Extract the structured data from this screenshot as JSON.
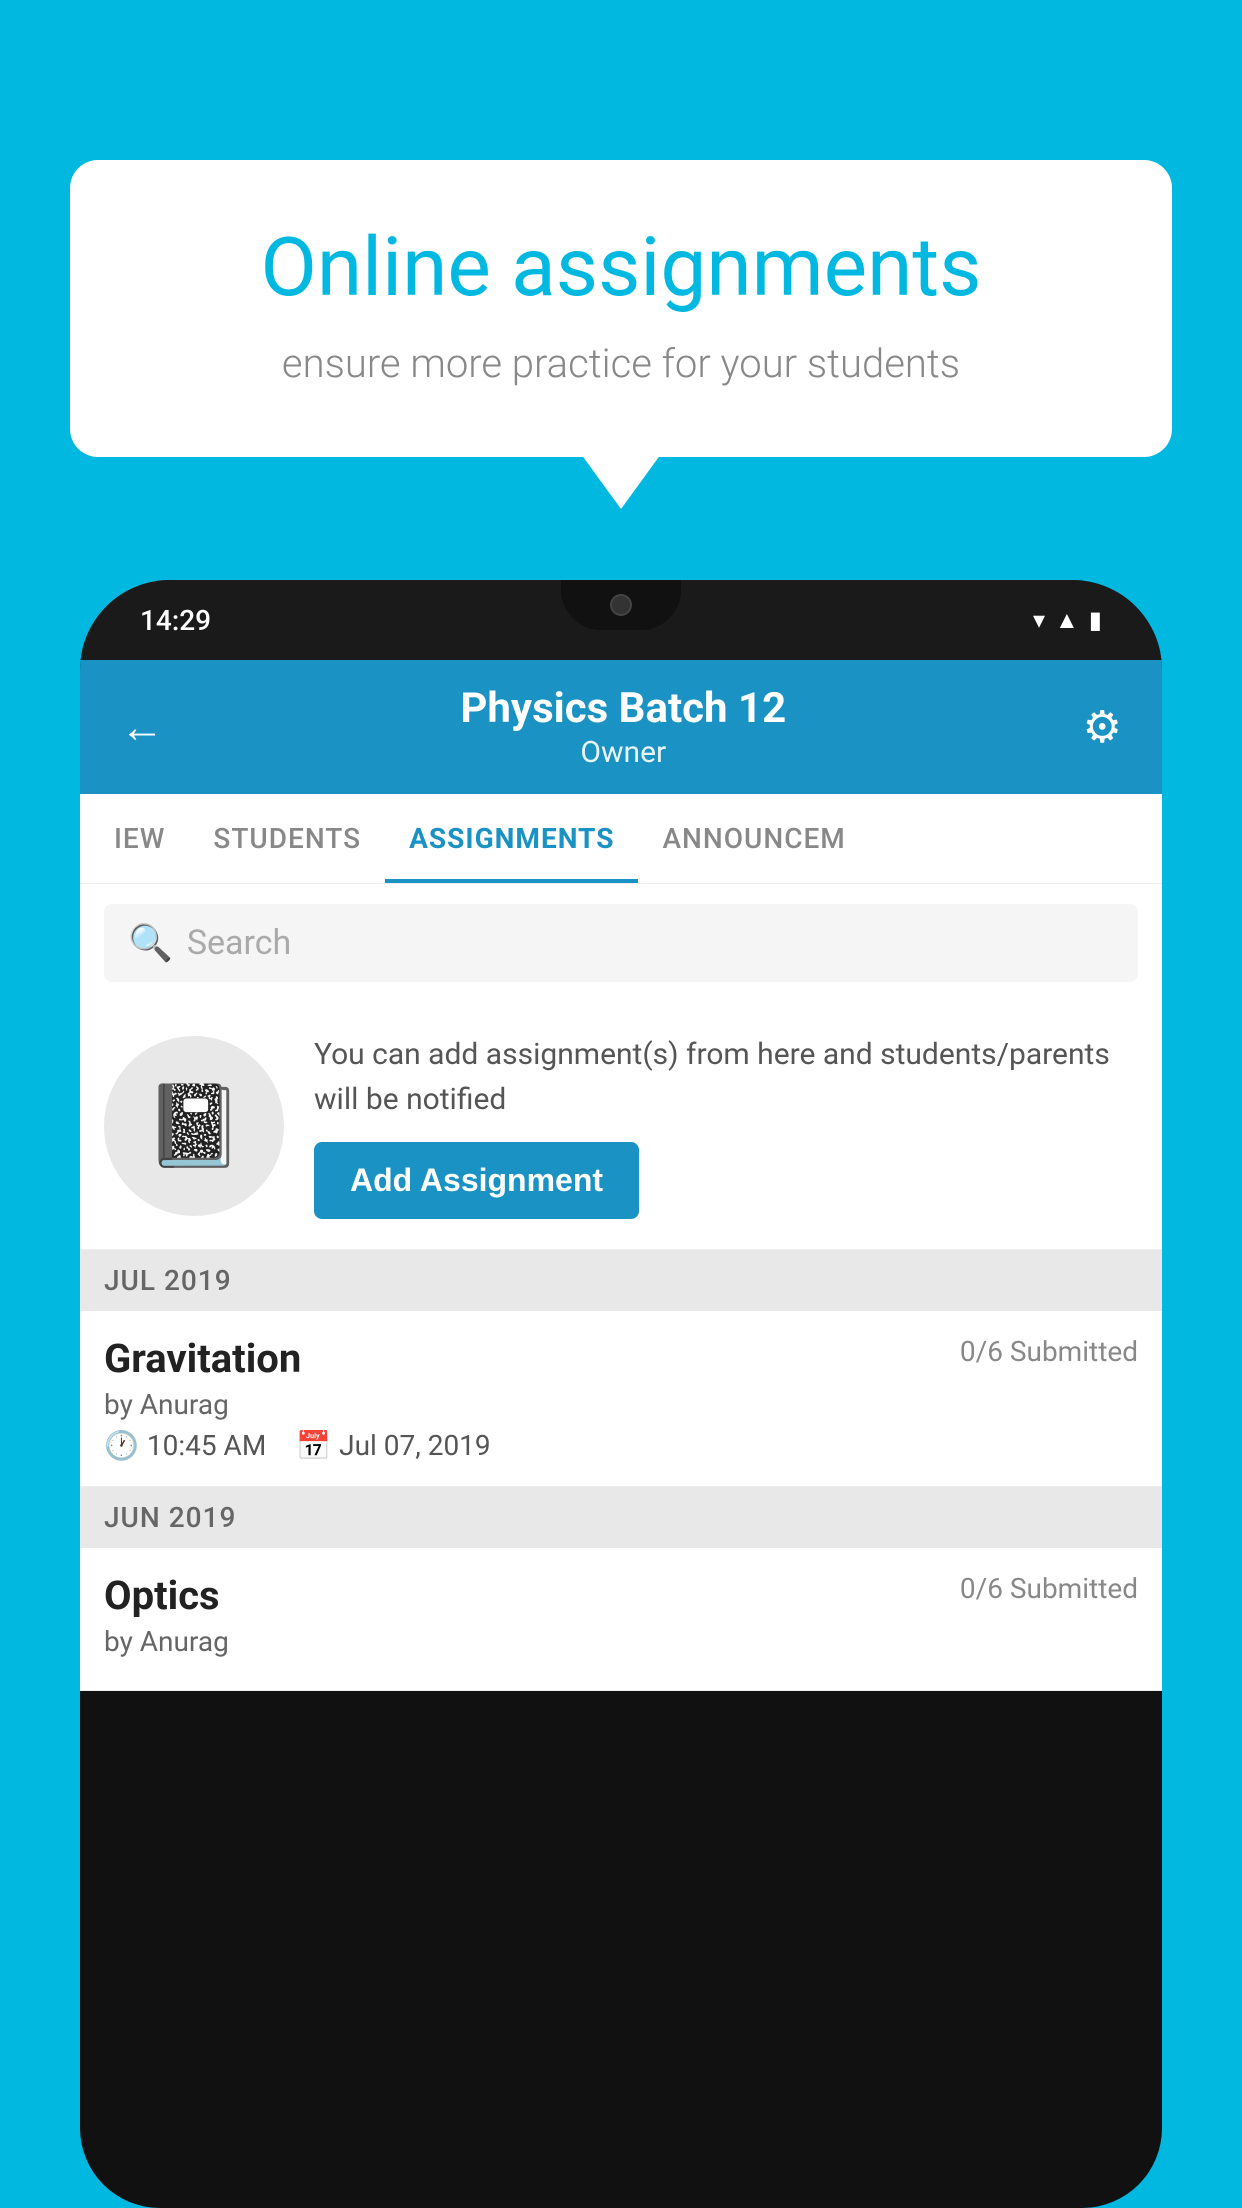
{
  "background_color": "#00b8e0",
  "speech_bubble": {
    "title": "Online assignments",
    "subtitle": "ensure more practice for your students"
  },
  "phone": {
    "status_bar": {
      "time": "14:29",
      "icons": [
        "wifi",
        "signal",
        "battery"
      ]
    },
    "header": {
      "title": "Physics Batch 12",
      "subtitle": "Owner",
      "back_label": "←",
      "settings_label": "⚙"
    },
    "tabs": [
      {
        "label": "IEW",
        "active": false
      },
      {
        "label": "STUDENTS",
        "active": false
      },
      {
        "label": "ASSIGNMENTS",
        "active": true
      },
      {
        "label": "ANNOUNCEM",
        "active": false
      }
    ],
    "search": {
      "placeholder": "Search"
    },
    "promo": {
      "text": "You can add assignment(s) from here and students/parents will be notified",
      "button_label": "Add Assignment"
    },
    "sections": [
      {
        "month": "JUL 2019",
        "assignments": [
          {
            "name": "Gravitation",
            "submitted": "0/6 Submitted",
            "by": "by Anurag",
            "time": "10:45 AM",
            "date": "Jul 07, 2019"
          }
        ]
      },
      {
        "month": "JUN 2019",
        "assignments": [
          {
            "name": "Optics",
            "submitted": "0/6 Submitted",
            "by": "by Anurag",
            "time": "",
            "date": ""
          }
        ]
      }
    ]
  }
}
